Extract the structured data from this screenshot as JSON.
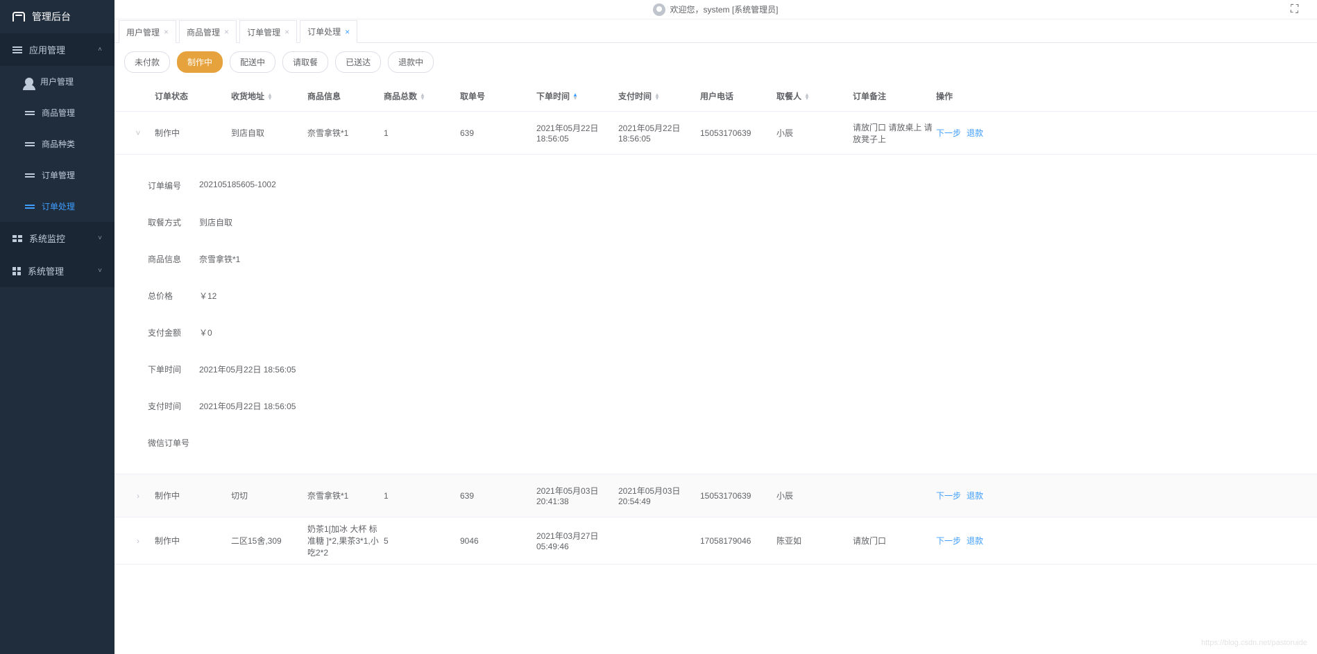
{
  "brand": "管理后台",
  "welcome": "欢迎您，system [系统管理员]",
  "sidebar": {
    "groups": [
      {
        "label": "应用管理",
        "expanded": true,
        "icon": "bars",
        "items": [
          {
            "label": "用户管理",
            "icon": "user"
          },
          {
            "label": "商品管理",
            "icon": "sliders"
          },
          {
            "label": "商品种类",
            "icon": "sliders"
          },
          {
            "label": "订单管理",
            "icon": "sliders"
          },
          {
            "label": "订单处理",
            "icon": "sliders",
            "active": true
          }
        ]
      },
      {
        "label": "系统监控",
        "expanded": false,
        "icon": "dash",
        "items": []
      },
      {
        "label": "系统管理",
        "expanded": false,
        "icon": "grid",
        "items": []
      }
    ]
  },
  "tabs": [
    {
      "label": "用户管理"
    },
    {
      "label": "商品管理"
    },
    {
      "label": "订单管理"
    },
    {
      "label": "订单处理",
      "active": true
    }
  ],
  "status_filters": [
    {
      "label": "未付款"
    },
    {
      "label": "制作中",
      "active": true
    },
    {
      "label": "配送中"
    },
    {
      "label": "请取餐"
    },
    {
      "label": "已送达"
    },
    {
      "label": "退款中"
    }
  ],
  "columns": {
    "status": "订单状态",
    "address": "收货地址",
    "goods": "商品信息",
    "count": "商品总数",
    "pickup": "取单号",
    "order_time": "下单时间",
    "pay_time": "支付时间",
    "phone": "用户电话",
    "receiver": "取餐人",
    "remark": "订单备注",
    "action": "操作"
  },
  "actions": {
    "next": "下一步",
    "refund": "退款"
  },
  "rows": [
    {
      "expanded": true,
      "status": "制作中",
      "address": "到店自取",
      "goods": "奈雪拿铁*1",
      "count": "1",
      "pickup": "639",
      "order_time": "2021年05月22日 18:56:05",
      "pay_time": "2021年05月22日 18:56:05",
      "phone": "15053170639",
      "receiver": "小辰",
      "remark": "请放门口 请放桌上 请放凳子上"
    },
    {
      "expanded": false,
      "status": "制作中",
      "address": "切切",
      "goods": "奈雪拿铁*1",
      "count": "1",
      "pickup": "639",
      "order_time": "2021年05月03日 20:41:38",
      "pay_time": "2021年05月03日 20:54:49",
      "phone": "15053170639",
      "receiver": "小辰",
      "remark": ""
    },
    {
      "expanded": false,
      "status": "制作中",
      "address": "二区15舍,309",
      "goods": "奶茶1[加冰 大杯 标准糖 ]*2,果茶3*1,小吃2*2",
      "count": "5",
      "pickup": "9046",
      "order_time": "2021年03月27日 05:49:46",
      "pay_time": "",
      "phone": "17058179046",
      "receiver": "陈亚如",
      "remark": "请放门口"
    }
  ],
  "detail": {
    "fields": [
      {
        "label": "订单编号",
        "value": "202105185605-1002"
      },
      {
        "label": "取餐方式",
        "value": "到店自取"
      },
      {
        "label": "商品信息",
        "value": "奈雪拿铁*1"
      },
      {
        "label": "总价格",
        "value": "￥12"
      },
      {
        "label": "支付金额",
        "value": "￥0"
      },
      {
        "label": "下单时间",
        "value": "2021年05月22日 18:56:05"
      },
      {
        "label": "支付时间",
        "value": "2021年05月22日 18:56:05"
      },
      {
        "label": "微信订单号",
        "value": ""
      }
    ]
  },
  "watermark": "https://blog.csdn.net/pastoruide"
}
